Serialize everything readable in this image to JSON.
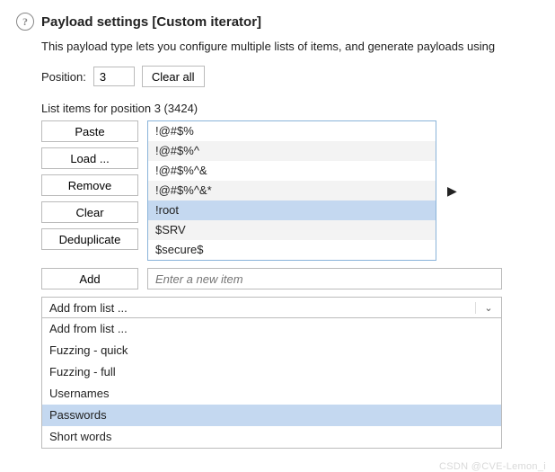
{
  "header": {
    "title": "Payload settings [Custom iterator]",
    "description": "This payload type lets you configure multiple lists of items, and generate payloads using"
  },
  "position": {
    "label": "Position:",
    "value": "3",
    "clear_label": "Clear all"
  },
  "list": {
    "label": "List items for position 3 (3424)",
    "buttons": {
      "paste": "Paste",
      "load": "Load ...",
      "remove": "Remove",
      "clear": "Clear",
      "dedup": "Deduplicate"
    },
    "items": [
      "!@#$%",
      "!@#$%^",
      "!@#$%^&",
      "!@#$%^&*",
      "!root",
      "$SRV",
      "$secure$"
    ],
    "selected_index": 4
  },
  "add": {
    "button": "Add",
    "placeholder": "Enter a new item"
  },
  "combo": {
    "selected": "Add from list ...",
    "options": [
      "Add from list ...",
      "Fuzzing - quick",
      "Fuzzing - full",
      "Usernames",
      "Passwords",
      "Short words"
    ],
    "highlight_index": 4
  },
  "watermark": "CSDN @CVE-Lemon_i"
}
